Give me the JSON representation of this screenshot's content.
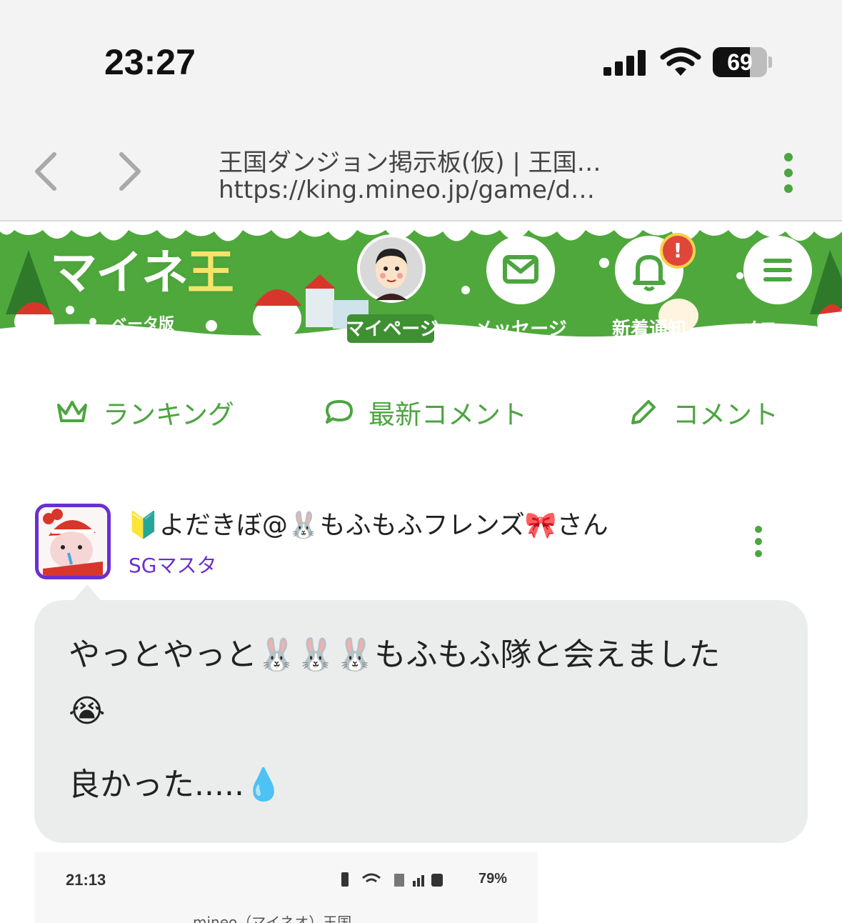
{
  "status_bar": {
    "time": "23:27",
    "battery_level": "69",
    "icons": [
      "cellular-signal-icon",
      "wifi-icon",
      "battery-icon"
    ]
  },
  "browser": {
    "tab_title": "王国ダンジョン掲示板(仮) | 王国…",
    "url": "https://king.mineo.jp/game/d…",
    "icons": [
      "back-arrow-icon",
      "forward-arrow-icon",
      "more-vertical-icon"
    ]
  },
  "header": {
    "logo_text": "マイネ",
    "logo_king": "王",
    "beta_label": "ベータ版",
    "nav": {
      "mypage": "マイページ",
      "message": "メッセージ",
      "notifications": "新着通知",
      "notification_badge": "!",
      "menu": "メニュー"
    }
  },
  "subnav": {
    "ranking": "ランキング",
    "latest_comments": "最新コメント",
    "comment": "コメント"
  },
  "post": {
    "user_name": "🔰よだきぼ@🐰もふもふフレンズ🎀さん",
    "user_rank": "SGマスタ",
    "body_line1": "やっとやっと🐰🐰🐰もふもふ隊と会えました",
    "body_line2": "😭",
    "body_line3": "良かった.....💧"
  },
  "attachment": {
    "time": "21:13",
    "battery": "79%",
    "title": "mineo（マイネオ）王国"
  },
  "colors": {
    "brand_green": "#4ca540",
    "rank_purple": "#6a2fd0",
    "bubble_bg": "#ebeded"
  }
}
